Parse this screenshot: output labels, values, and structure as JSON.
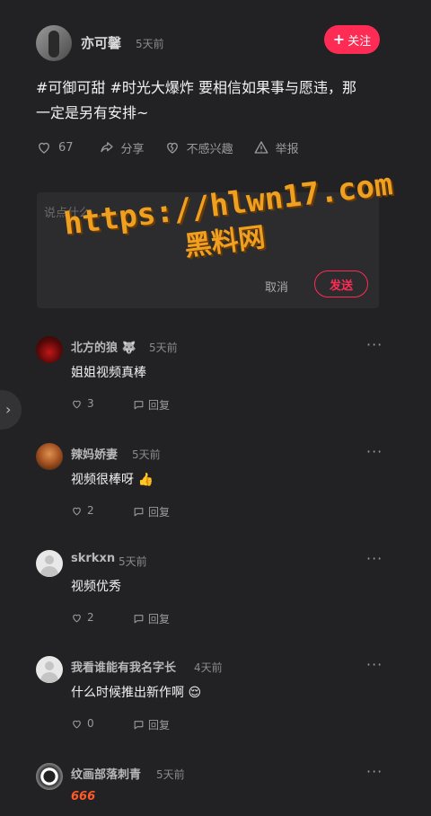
{
  "post": {
    "author": "亦可馨",
    "time": "5天前",
    "follow_label": "关注",
    "text_line1": "#可御可甜 #时光大爆炸 要相信如果事与愿违，那",
    "text_line2": "一定是另有安排~",
    "like_count": "67",
    "share_label": "分享",
    "not_interested_label": "不感兴趣",
    "report_label": "举报"
  },
  "composer": {
    "placeholder": "说点什么...",
    "cancel_label": "取消",
    "send_label": "发送"
  },
  "watermark": {
    "line1": "https://hlwn17.com",
    "line2": "黑料网"
  },
  "comments": [
    {
      "name": "北方的狼 🐺",
      "time": "5天前",
      "text": "姐姐视频真棒",
      "likes": "3",
      "reply_label": "回复"
    },
    {
      "name": "辣妈娇妻",
      "time": "5天前",
      "text": "视频很棒呀 👍",
      "likes": "2",
      "reply_label": "回复"
    },
    {
      "name": "skrkxn",
      "time": "5天前",
      "text": "视频优秀",
      "likes": "2",
      "reply_label": "回复"
    },
    {
      "name": "我看谁能有我名字长",
      "time": "4天前",
      "text": "什么时候推出新作啊 😌",
      "likes": "0",
      "reply_label": "回复"
    },
    {
      "name": "纹画部落刺青",
      "time": "5天前",
      "text": "666"
    }
  ],
  "colors": {
    "accent": "#fe2c55",
    "background": "#222224",
    "watermark": "#f0a020"
  }
}
